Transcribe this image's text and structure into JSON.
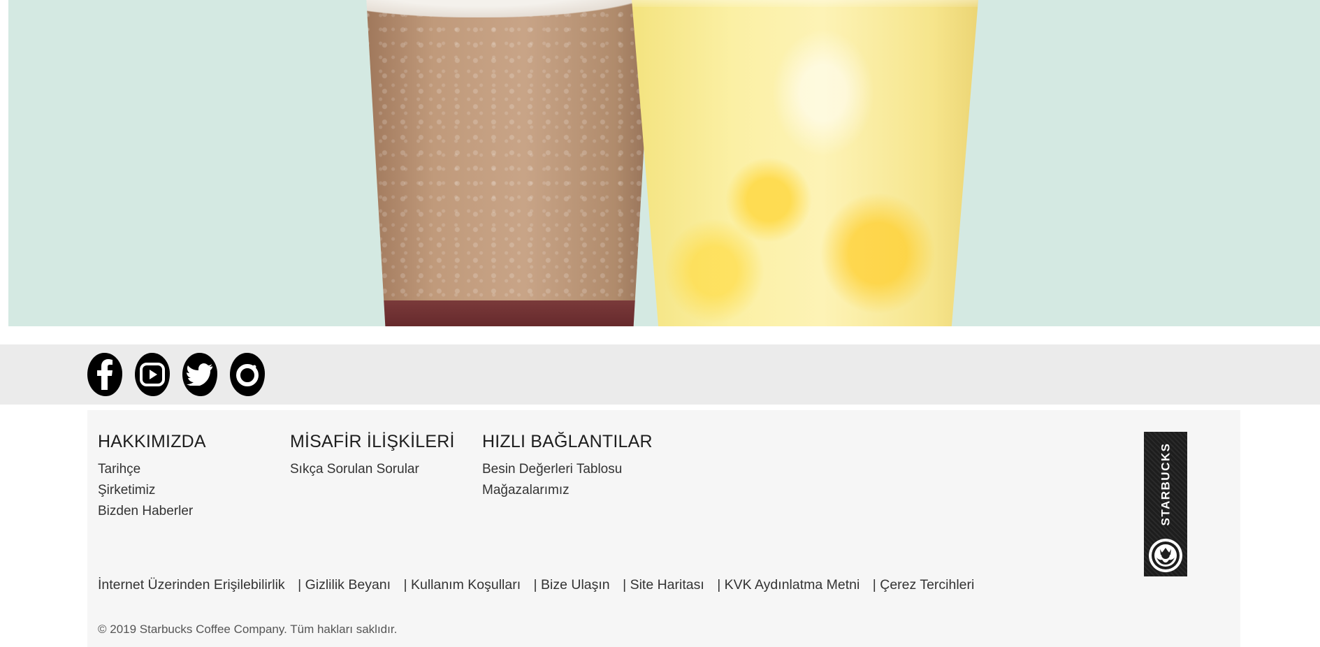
{
  "hero": {
    "image": "frappuccino-and-lemonade-drinks"
  },
  "social": {
    "items": [
      {
        "name": "facebook",
        "icon": "facebook-icon"
      },
      {
        "name": "youtube",
        "icon": "youtube-icon"
      },
      {
        "name": "twitter",
        "icon": "twitter-icon"
      },
      {
        "name": "instagram",
        "icon": "instagram-icon"
      }
    ]
  },
  "footer": {
    "columns": [
      {
        "heading": "HAKKIMIZDA",
        "links": [
          "Tarihçe",
          "Şirketimiz",
          "Bizden Haberler"
        ]
      },
      {
        "heading": "MİSAFİR İLİŞKİLERİ",
        "links": [
          "Sıkça Sorulan Sorular"
        ]
      },
      {
        "heading": "HIZLI BAĞLANTILAR",
        "links": [
          "Besin Değerleri Tablosu",
          "Mağazalarımız"
        ]
      }
    ],
    "badge_text": "STARBUCKS",
    "bottom_links": [
      "İnternet Üzerinden Erişilebilirlik",
      "Gizlilik Beyanı",
      "Kullanım Koşulları",
      "Bize Ulaşın",
      "Site Haritası",
      "KVK Aydınlatma Metni",
      "Çerez Tercihleri"
    ],
    "separator": "|",
    "copyright": "© 2019 Starbucks Coffee Company. Tüm hakları saklıdır."
  },
  "colors": {
    "hero_bg": "#d4e9e2",
    "social_bar": "#ebebeb",
    "footer_bg": "#f6f6f6"
  }
}
